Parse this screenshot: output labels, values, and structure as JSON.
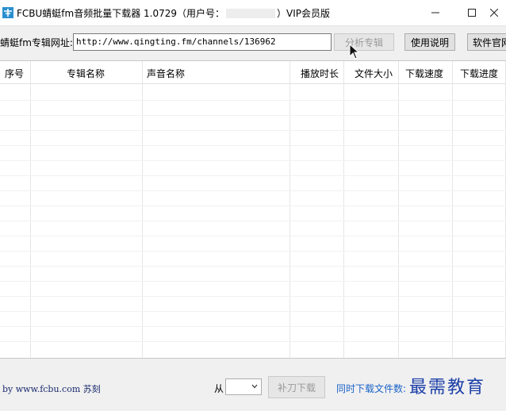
{
  "window": {
    "title_prefix": "FCBU蜻蜓fm音频批量下载器 1.0729（用户号：",
    "title_suffix": "）VIP会员版",
    "minimize_glyph": "—",
    "maximize_glyph": "☐",
    "close_glyph": "×"
  },
  "url_bar": {
    "label": "蜻蜓fm专辑网址:",
    "value": "http://www.qingting.fm/channels/136962",
    "analyze_button": "分析专辑",
    "help_button": "使用说明",
    "site_button": "软件官网"
  },
  "table": {
    "columns": [
      "序号",
      "专辑名称",
      "声音名称",
      "播放时长",
      "文件大小",
      "下载速度",
      "下载进度"
    ],
    "rows": []
  },
  "footer": {
    "credit": "by www.fcbu.com 苏刻",
    "from_label": "从",
    "from_value": "",
    "supplement_button": "补刀下载",
    "concurrent_label": "同时下载文件数:",
    "watermark": "最需教育"
  },
  "icons": {
    "app": "app-logo-icon",
    "minimize": "minimize-icon",
    "maximize": "maximize-icon",
    "close": "close-icon",
    "cursor": "mouse-cursor-icon",
    "dropdown": "chevron-down-icon"
  },
  "colors": {
    "accent_blue": "#1a63c9",
    "app_icon": "#2a8fd0",
    "watermark": "#1d3fa8"
  }
}
